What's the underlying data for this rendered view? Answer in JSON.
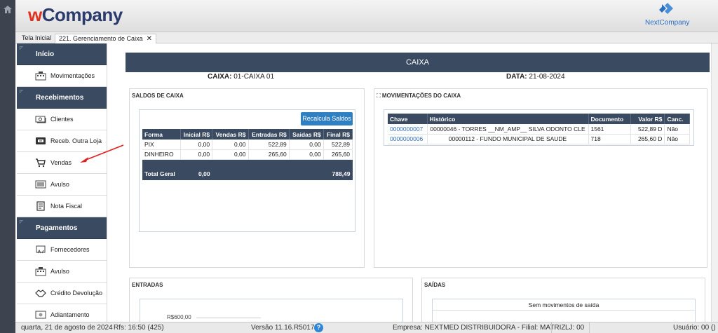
{
  "header": {
    "brand_w": "w",
    "brand_rest": "Company",
    "right_logo": "NextCompany"
  },
  "tabs": [
    {
      "label": "Tela Inicial"
    },
    {
      "label": "221. Gerenciamento de Caixa"
    }
  ],
  "tab_close": "✕",
  "sidebar": {
    "sections": [
      {
        "title": "Início",
        "items": [
          {
            "label": "Movimentações",
            "icon": "building-icon"
          }
        ]
      },
      {
        "title": "Recebimentos",
        "items": [
          {
            "label": "Clientes",
            "icon": "cash-icon"
          },
          {
            "label": "Receb. Outra Loja",
            "icon": "transfer-icon"
          },
          {
            "label": "Vendas",
            "icon": "cart-icon"
          },
          {
            "label": "Avulso",
            "icon": "money-icon"
          },
          {
            "label": "Nota Fiscal",
            "icon": "document-icon"
          }
        ]
      },
      {
        "title": "Pagamentos",
        "items": [
          {
            "label": "Fornecedores",
            "icon": "supplier-icon"
          },
          {
            "label": "Avulso",
            "icon": "building-icon"
          },
          {
            "label": "Crédito Devolução",
            "icon": "handshake-icon"
          },
          {
            "label": "Adiantamento",
            "icon": "money-icon"
          }
        ]
      }
    ]
  },
  "main": {
    "banner": "CAIXA",
    "caixa_label": "CAIXA:",
    "caixa_value": "01-CAIXA 01",
    "data_label": "DATA:",
    "data_value": "21-08-2024",
    "saldos": {
      "title": "SALDOS DE CAIXA",
      "recalc_button": "Recalcula Saldos",
      "columns": [
        "Forma",
        "Inicial R$",
        "Vendas R$",
        "Entradas R$",
        "Saidas R$",
        "Final R$"
      ],
      "rows": [
        [
          "PIX",
          "0,00",
          "0,00",
          "522,89",
          "0,00",
          "522,89"
        ],
        [
          "DINHEIRO",
          "0,00",
          "0,00",
          "265,60",
          "0,00",
          "265,60"
        ]
      ],
      "total_label": "Total Geral",
      "total_inicial": "0,00",
      "total_final": "788,49"
    },
    "movimentacoes": {
      "title": "MOVIMENTAÇÕES DO CAIXA",
      "columns": [
        "Chave",
        "Histórico",
        "Documento",
        "Valor R$",
        "Canc."
      ],
      "rows": [
        [
          "0000000007",
          "00000046 - TORRES __NM_AMP__ SILVA ODONTO CLE",
          "1561",
          "522,89 D",
          "Não"
        ],
        [
          "0000000006",
          "00000112 - FUNDO MUNICIPAL DE SAUDE",
          "718",
          "265,60 D",
          "Não"
        ]
      ]
    },
    "entradas": {
      "title": "ENTRADAS",
      "axis_label": "R$600,00"
    },
    "saidas": {
      "title": "SAÍDAS",
      "empty_text": "Sem movimentos de saída"
    }
  },
  "statusbar": {
    "date": "quarta, 21 de agosto de 2024",
    "rfs": "Rfs: 16:50 (425)",
    "version": "Versão 11.16.R5017",
    "help": "?",
    "empresa": "Empresa: NEXTMED DISTRIBUIDORA - Filial: MATRIZ",
    "lj": "LJ: 00",
    "usuario": "Usuário: 00 ()"
  },
  "colors": {
    "navy": "#3a4a60",
    "accent_blue": "#2f7fc3",
    "brand_red": "#e0301e",
    "brand_navy": "#2b3b6b",
    "arrow_red": "#e02020"
  }
}
